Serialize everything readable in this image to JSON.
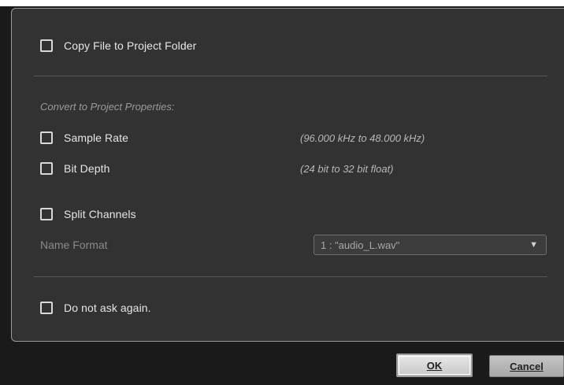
{
  "dialog": {
    "copy_file_label": "Copy File to Project Folder",
    "convert_section_title": "Convert to Project Properties:",
    "sample_rate_label": "Sample Rate",
    "sample_rate_info": "(96.000 kHz to 48.000 kHz)",
    "bit_depth_label": "Bit Depth",
    "bit_depth_info": "(24 bit to 32 bit float)",
    "split_channels_label": "Split Channels",
    "name_format_label": "Name Format",
    "name_format_value": "1 : \"audio_L.wav\"",
    "do_not_ask_label": "Do not ask again."
  },
  "buttons": {
    "ok_label": "OK",
    "cancel_label": "Cancel"
  },
  "icons": {
    "dropdown_arrow": "▼"
  },
  "checkboxes": {
    "copy_file": false,
    "sample_rate": false,
    "bit_depth": false,
    "split_channels": false,
    "do_not_ask": false
  }
}
